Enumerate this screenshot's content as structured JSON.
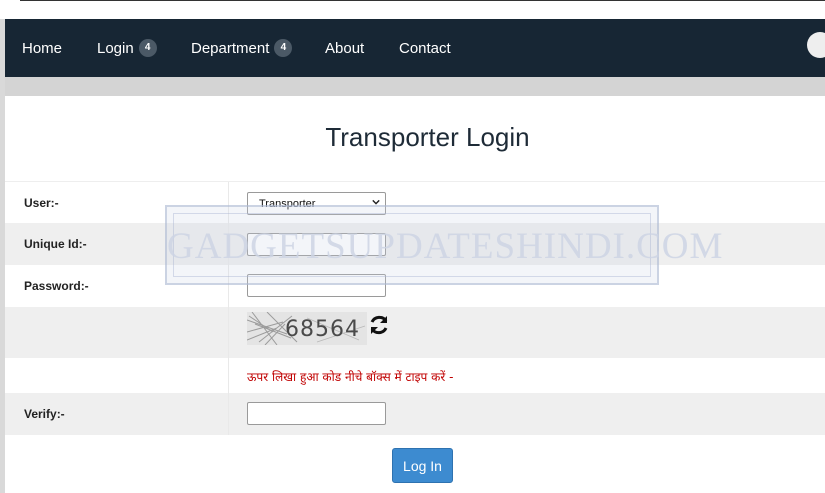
{
  "nav": {
    "items": [
      {
        "label": "Home"
      },
      {
        "label": "Login",
        "badge": "4"
      },
      {
        "label": "Department",
        "badge": "4"
      },
      {
        "label": "About"
      },
      {
        "label": "Contact"
      }
    ]
  },
  "page": {
    "title": "Transporter Login"
  },
  "form": {
    "user_label": "User:-",
    "user_selected": "Transporter",
    "unique_id_label": "Unique Id:-",
    "unique_id_value": "",
    "password_label": "Password:-",
    "password_value": "",
    "captcha_code": "68564",
    "captcha_hint": "ऊपर लिखा हुआ कोड नीचे बॉक्स में टाइप करें -",
    "verify_label": "Verify:-",
    "verify_value": "",
    "submit_label": "Log In"
  },
  "watermark": {
    "text": "GADGETSUPDATESHINDI.COM"
  },
  "colors": {
    "navbar": "#172634",
    "button": "#3d8bd0",
    "hint": "#c00000"
  },
  "icons": {
    "refresh": "refresh-icon",
    "dropdown": "chevron-down-icon"
  }
}
